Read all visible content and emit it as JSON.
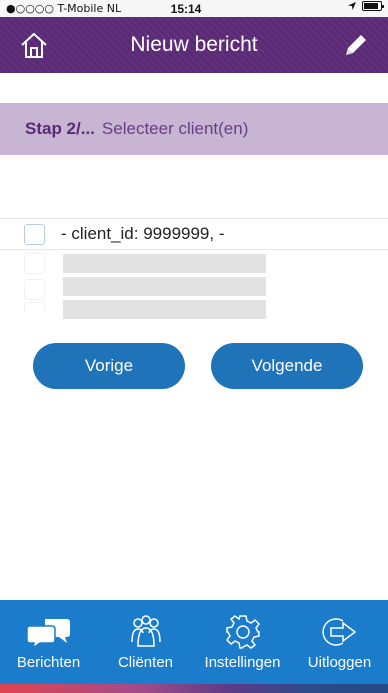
{
  "status_bar": {
    "carrier": "●○○○○ T-Mobile NL",
    "time": "15:14"
  },
  "header": {
    "title": "Nieuw bericht",
    "left_icon": "home-icon",
    "right_icon": "pencil-icon"
  },
  "step": {
    "label": "Stap 2/...",
    "description": "Selecteer client(en)"
  },
  "clients": [
    {
      "label": "- client_id: 9999999, -",
      "checked": false
    }
  ],
  "buttons": {
    "previous": "Vorige",
    "next": "Volgende"
  },
  "tabs": [
    {
      "label": "Berichten",
      "icon": "chat-bubbles-icon"
    },
    {
      "label": "Cliënten",
      "icon": "people-icon"
    },
    {
      "label": "Instellingen",
      "icon": "gear-icon"
    },
    {
      "label": "Uitloggen",
      "icon": "logout-icon"
    }
  ],
  "colors": {
    "header": "#5b2a76",
    "step_bar": "#c7b5d3",
    "button": "#1f73b9",
    "tab_bar": "#1a7cca"
  }
}
